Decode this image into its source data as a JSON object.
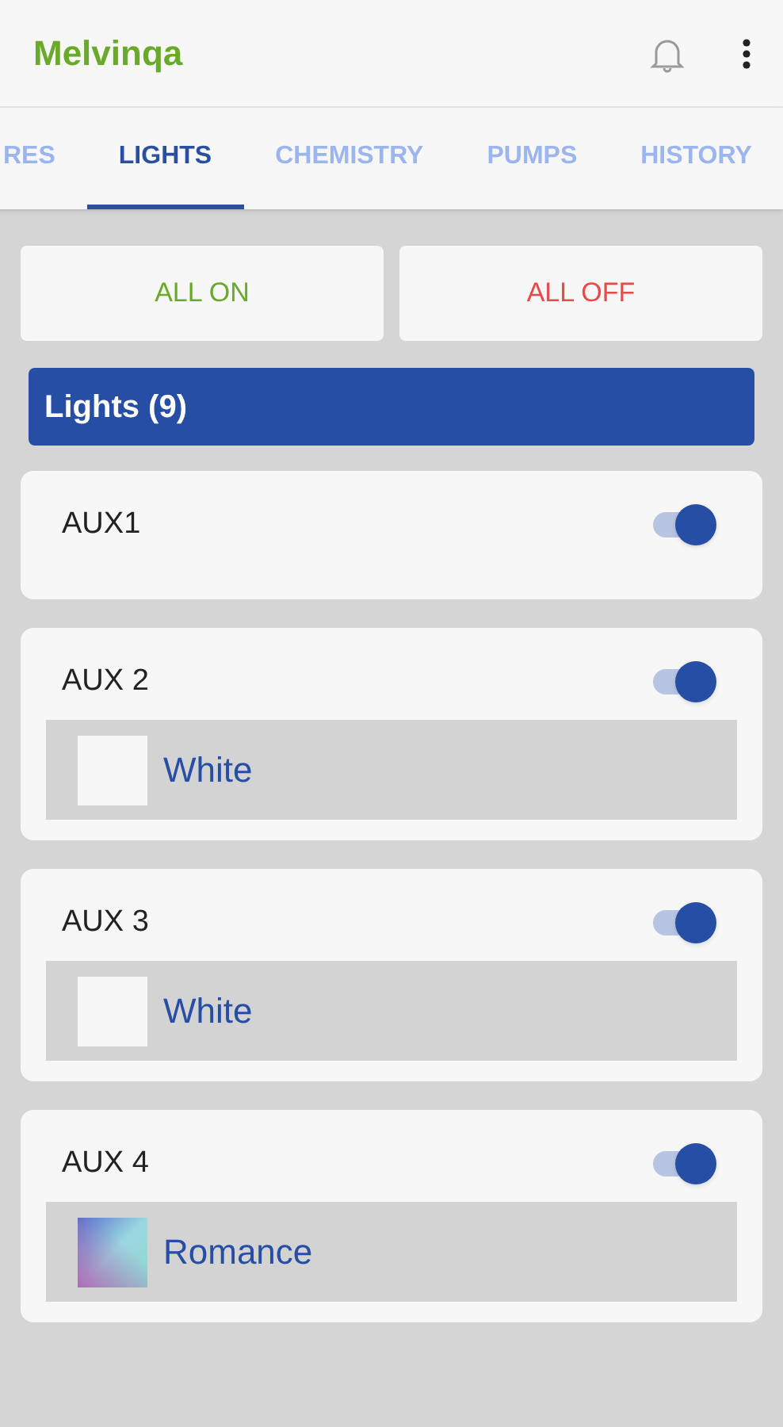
{
  "app_bar": {
    "title": "Melvinqa"
  },
  "tabs": [
    {
      "label": "RES",
      "selected": false
    },
    {
      "label": "LIGHTS",
      "selected": true
    },
    {
      "label": "CHEMISTRY",
      "selected": false
    },
    {
      "label": "PUMPS",
      "selected": false
    },
    {
      "label": "HISTORY",
      "selected": false
    }
  ],
  "actions": [
    {
      "label": "ALL ON",
      "kind": "on"
    },
    {
      "label": "ALL OFF",
      "kind": "off"
    }
  ],
  "section": {
    "title": "Lights (9)"
  },
  "lights": [
    {
      "name": "AUX1",
      "on": true
    },
    {
      "name": "AUX 2",
      "on": true,
      "color": {
        "name": "White",
        "kind": "solid"
      }
    },
    {
      "name": "AUX 3",
      "on": true,
      "color": {
        "name": "White",
        "kind": "solid"
      }
    },
    {
      "name": "AUX 4",
      "on": true,
      "color": {
        "name": "Romance",
        "kind": "gradient"
      }
    }
  ]
}
